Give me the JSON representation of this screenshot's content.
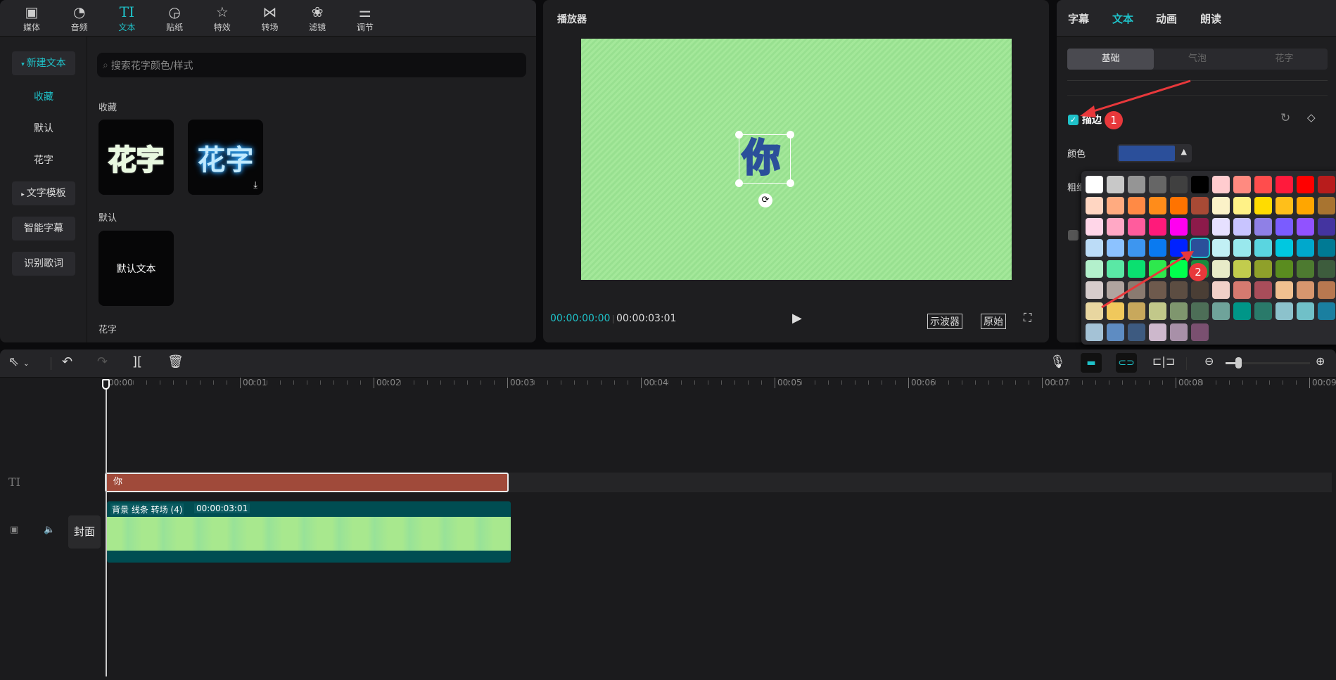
{
  "toolbar": {
    "tabs": [
      {
        "label": "媒体",
        "icon": "media-icon",
        "active": false
      },
      {
        "label": "音频",
        "icon": "audio-icon",
        "active": false
      },
      {
        "label": "文本",
        "icon": "text-icon",
        "active": true
      },
      {
        "label": "贴纸",
        "icon": "sticker-icon",
        "active": false
      },
      {
        "label": "特效",
        "icon": "effects-icon",
        "active": false
      },
      {
        "label": "转场",
        "icon": "transition-icon",
        "active": false
      },
      {
        "label": "滤镜",
        "icon": "filter-icon",
        "active": false
      },
      {
        "label": "调节",
        "icon": "adjust-icon",
        "active": false
      }
    ]
  },
  "sidebar": {
    "new_text": "新建文本",
    "items": [
      "收藏",
      "默认",
      "花字"
    ],
    "groups": [
      "文字模板",
      "智能字幕",
      "识别歌词"
    ]
  },
  "library": {
    "search_placeholder": "搜索花字颜色/样式",
    "section_favorites": "收藏",
    "fancy_preview": "花字",
    "section_default": "默认",
    "default_card": "默认文本",
    "section_fancy": "花字"
  },
  "player": {
    "title": "播放器",
    "preview_text": "你",
    "current_time": "00:00:00:00",
    "total_time": "00:00:03:01",
    "scope_button": "示波器",
    "original_button": "原始"
  },
  "inspector": {
    "tabs": [
      "字幕",
      "文本",
      "动画",
      "朗读"
    ],
    "active_tab": "文本",
    "subtabs": [
      "基础",
      "气泡",
      "花字"
    ],
    "active_subtab": "基础",
    "stroke_label": "描边",
    "stroke_checked": true,
    "color_label": "颜色",
    "thickness_label": "粗细",
    "stroke_color": "#2b4f9a",
    "annotation_1": "1",
    "annotation_2": "2",
    "palette": [
      [
        "#ffffff",
        "#c8c8c8",
        "#959595",
        "#666666",
        "#404040",
        "#000000",
        "#ffcccf",
        "#ff8a80",
        "#ff4d4d",
        "#ff1a3c",
        "#ff0000",
        "#b81c1c"
      ],
      [
        "#ffd6c2",
        "#ffab80",
        "#ff8a45",
        "#ff8c1a",
        "#ff7300",
        "#a84a35",
        "#fbf2c8",
        "#fff287",
        "#ffdc00",
        "#ffbf1a",
        "#ffa600",
        "#a87430"
      ],
      [
        "#ffd6e8",
        "#ffa8c5",
        "#ff5c9d",
        "#ff1a7a",
        "#ff00f0",
        "#8c1a4a",
        "#e6e0ff",
        "#c8c4ff",
        "#8f80e6",
        "#7a5cff",
        "#9152ff",
        "#4434a0"
      ],
      [
        "#bcdcf7",
        "#8cc2ff",
        "#3d96f0",
        "#0a7af0",
        "#0022ff",
        "#2b4f9a",
        "#c2f0f5",
        "#99e8ed",
        "#5ad5e0",
        "#00c8e0",
        "#00a8cc",
        "#007a94"
      ],
      [
        "#b3f0cc",
        "#5ae8a5",
        "#0ae070",
        "#2ee84d",
        "#00ff4d",
        "#1a8c3d",
        "#e8ebc8",
        "#c2cc4d",
        "#8fa02a",
        "#5a8c1f",
        "#4d7a30",
        "#3d5c3d"
      ],
      [
        "#d6cccc",
        "#b0a49f",
        "#8a7a70",
        "#6e5a4d",
        "#5c4d42",
        "#4a3e35",
        "#f0d0c8",
        "#d67a70",
        "#a84d5a",
        "#f0c090",
        "#d6966e",
        "#b87850"
      ],
      [
        "#e8d6a0",
        "#f0c85c",
        "#c8a85c",
        "#c2c88a",
        "#7f966e",
        "#4d6e57",
        "#6fa39a",
        "#009688",
        "#2a7a6a",
        "#8cc2cc",
        "#70c0c8",
        "#1a7fa0"
      ],
      [
        "#a4c2d6",
        "#5e8cc2",
        "#3d5a80",
        "#cdb8cc",
        "#a890a8",
        "#7a5070"
      ]
    ]
  },
  "timeline": {
    "ruler": [
      "00:00",
      "00:01",
      "00:02",
      "00:03",
      "00:04",
      "00:05",
      "00:06",
      "00:07",
      "00:08",
      "00:09"
    ],
    "text_clip": "你",
    "video_clip_name": "背景 线条 转场 (4)",
    "video_clip_duration": "00:00:03:01",
    "cover_label": "封面",
    "text_track_icon": "TI",
    "zoom_level": 0.15
  },
  "colors": {
    "accent": "#1fc2c9",
    "text_clip": "#a04a3a",
    "video_clip": "#004d52",
    "annotation": "#e8383b"
  }
}
